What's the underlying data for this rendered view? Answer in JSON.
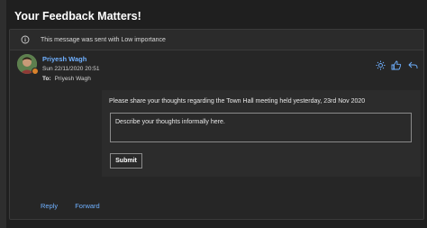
{
  "email": {
    "subject": "Your Feedback Matters!",
    "importance_notice": "This message was sent with Low importance",
    "sender_name": "Priyesh Wagh",
    "datetime": "Sun 22/11/2020 20:51",
    "to_label": "To:",
    "to_value": "Priyesh Wagh"
  },
  "form": {
    "prompt": "Please share your thoughts regarding the Town Hall meeting held yesterday, 23rd Nov 2020",
    "placeholder": "Describe your thoughts informally here.",
    "submit_label": "Submit"
  },
  "footer": {
    "reply": "Reply",
    "forward": "Forward"
  },
  "colors": {
    "accent": "#6fb0ff",
    "presence": "#d9822b"
  },
  "icons": [
    "info-icon",
    "sun-icon",
    "like-icon",
    "reply-icon"
  ]
}
